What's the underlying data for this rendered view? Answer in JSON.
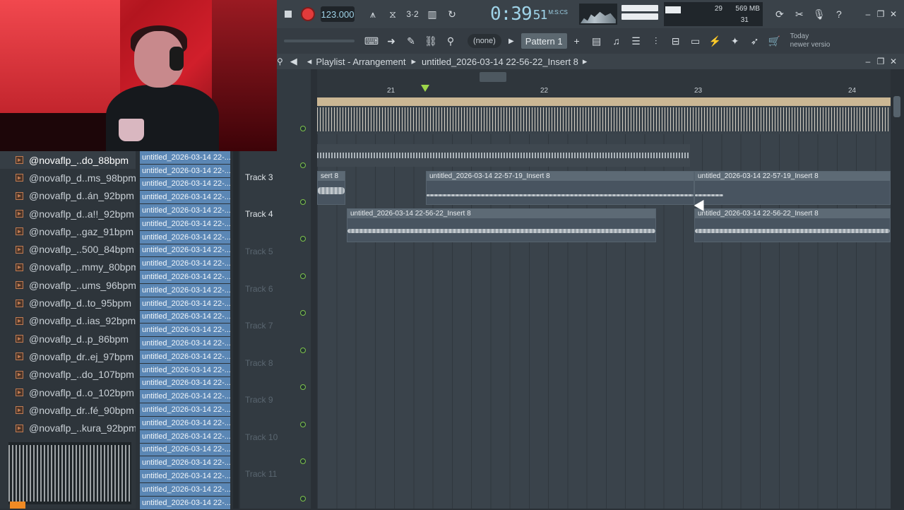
{
  "toolbar": {
    "tempo": "123.000",
    "time": "0:39",
    "time_sub": "51",
    "time_unit": "M:S:CS",
    "cpu_value": "29",
    "memory": "569 MB",
    "polyphony": "31",
    "pattern_none": "(none)",
    "pattern_name": "Pattern 1",
    "hint_line1": "Today",
    "hint_line2": "newer versio"
  },
  "playlist": {
    "title": "Playlist - Arrangement",
    "path": "untitled_2026-03-14 22-56-22_Insert 8",
    "ruler": [
      "21",
      "22",
      "23",
      "24"
    ],
    "tracks": [
      "Track 3",
      "Track 4",
      "Track 5",
      "Track 6",
      "Track 7",
      "Track 8",
      "Track 9",
      "Track 10",
      "Track 11"
    ],
    "clips": {
      "t3a": "sert 8",
      "t3b": "untitled_2026-03-14 22-57-19_Insert 8",
      "t3c": "untitled_2026-03-14 22-57-19_Insert 8",
      "t4a": "untitled_2026-03-14 22-56-22_Insert 8",
      "t4b": "untitled_2026-03-14 22-56-22_Insert 8"
    }
  },
  "browser": {
    "items": [
      "@novaflp_..do_88bpm",
      "@novaflp_d..ms_98bpm",
      "@novaflp_d..án_92bpm",
      "@novaflp_d..a!!_92bpm",
      "@novaflp_..gaz_91bpm",
      "@novaflp_..500_84bpm",
      "@novaflp_..mmy_80bpm",
      "@novaflp_..ums_96bpm",
      "@novaflp_d..to_95bpm",
      "@novaflp_d..ias_92bpm",
      "@novaflp_d..p_86bpm",
      "@novaflp_dr..ej_97bpm",
      "@novaflp_..do_107bpm",
      "@novaflp_d..o_102bpm",
      "@novaflp_dr..fé_90bpm",
      "@novaflp_..kura_92bpm"
    ]
  },
  "clip_list": {
    "label": "untitled_2026-03-14 22-..."
  }
}
